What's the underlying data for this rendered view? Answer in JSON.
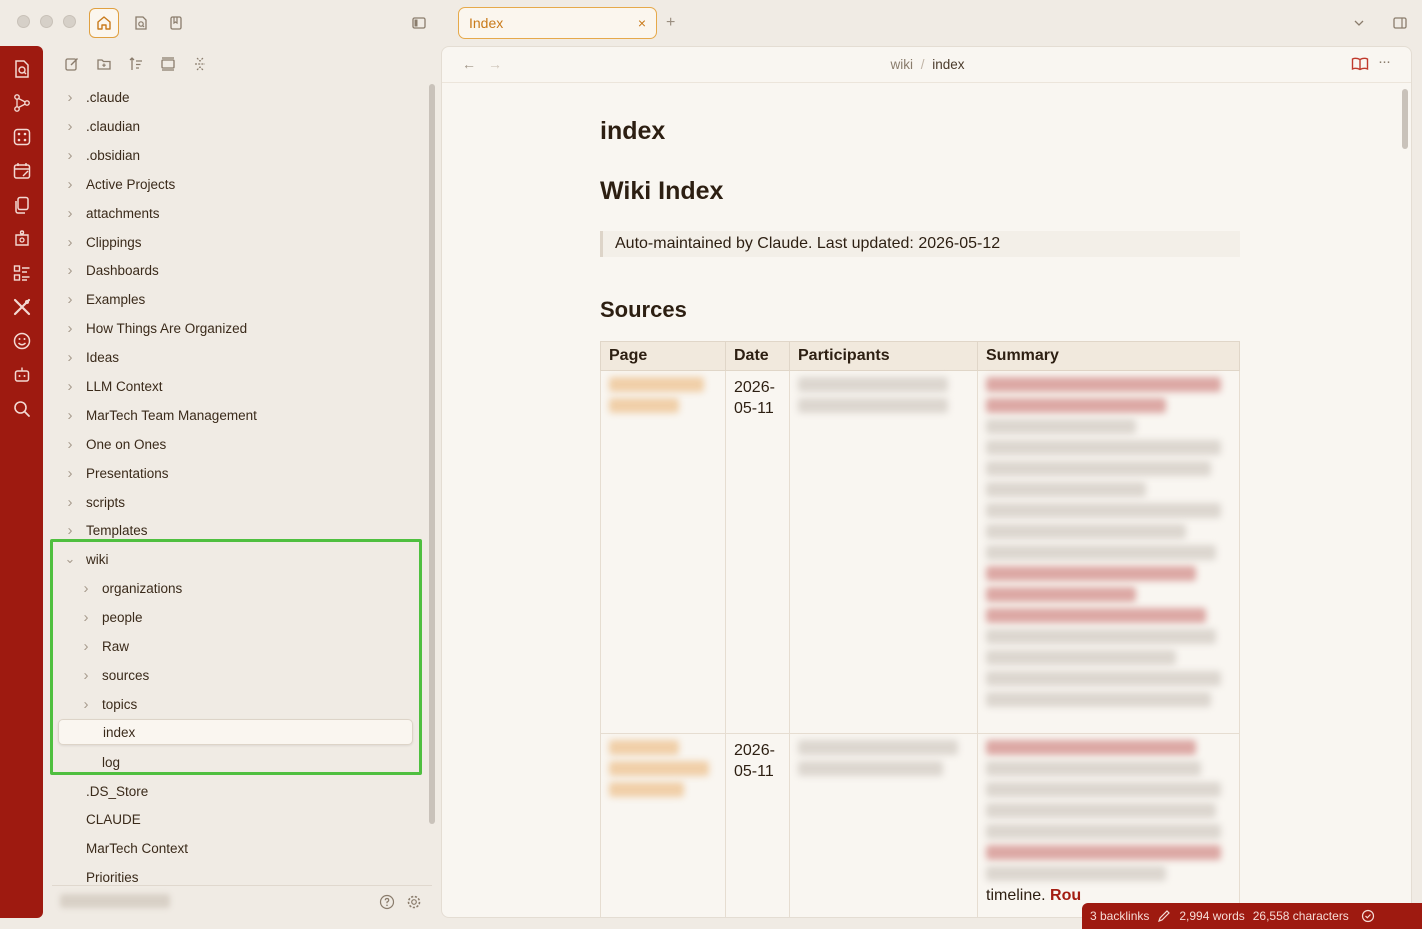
{
  "tab": {
    "label": "Index",
    "close": "×",
    "new": "+"
  },
  "sidebar": {
    "items": [
      {
        "label": ".claude",
        "kind": "folder"
      },
      {
        "label": ".claudian",
        "kind": "folder"
      },
      {
        "label": ".obsidian",
        "kind": "folder"
      },
      {
        "label": "Active Projects",
        "kind": "folder"
      },
      {
        "label": "attachments",
        "kind": "folder"
      },
      {
        "label": "Clippings",
        "kind": "folder"
      },
      {
        "label": "Dashboards",
        "kind": "folder"
      },
      {
        "label": "Examples",
        "kind": "folder"
      },
      {
        "label": "How Things Are Organized",
        "kind": "folder"
      },
      {
        "label": "Ideas",
        "kind": "folder"
      },
      {
        "label": "LLM Context",
        "kind": "folder"
      },
      {
        "label": "MarTech Team Management",
        "kind": "folder"
      },
      {
        "label": "One on Ones",
        "kind": "folder"
      },
      {
        "label": "Presentations",
        "kind": "folder"
      },
      {
        "label": "scripts",
        "kind": "folder"
      },
      {
        "label": "Templates",
        "kind": "folder"
      },
      {
        "label": "wiki",
        "kind": "folder-open"
      },
      {
        "label": "organizations",
        "kind": "folder"
      },
      {
        "label": "people",
        "kind": "folder"
      },
      {
        "label": "Raw",
        "kind": "folder"
      },
      {
        "label": "sources",
        "kind": "folder"
      },
      {
        "label": "topics",
        "kind": "folder"
      },
      {
        "label": "index",
        "kind": "file-selected"
      },
      {
        "label": "log",
        "kind": "file"
      },
      {
        "label": ".DS_Store",
        "kind": "file"
      },
      {
        "label": "CLAUDE",
        "kind": "file"
      },
      {
        "label": "MarTech Context",
        "kind": "file"
      },
      {
        "label": "Priorities",
        "kind": "file"
      }
    ]
  },
  "header": {
    "back": "←",
    "forward": "→",
    "breadcrumb_parent": "wiki",
    "breadcrumb_sep": "/",
    "breadcrumb_current": "index",
    "more": "···"
  },
  "note": {
    "title": "index",
    "h1": "Wiki Index",
    "quote": "Auto-maintained by Claude. Last updated: 2026-05-12",
    "h2": "Sources",
    "table": {
      "headers": [
        "Page",
        "Date",
        "Participants",
        "Summary"
      ],
      "rows": [
        {
          "date": "2026-\n05-11"
        },
        {
          "date": "2026-\n05-11",
          "summary_tail": "timeline.",
          "summary_link": "Rou"
        }
      ]
    }
  },
  "status": {
    "backlinks": "3 backlinks",
    "words": "2,994 words",
    "chars": "26,558 characters"
  },
  "colors": {
    "ribbon": "#9e1a10",
    "accent": "#e6a94a",
    "highlight": "#4fbf3f"
  }
}
